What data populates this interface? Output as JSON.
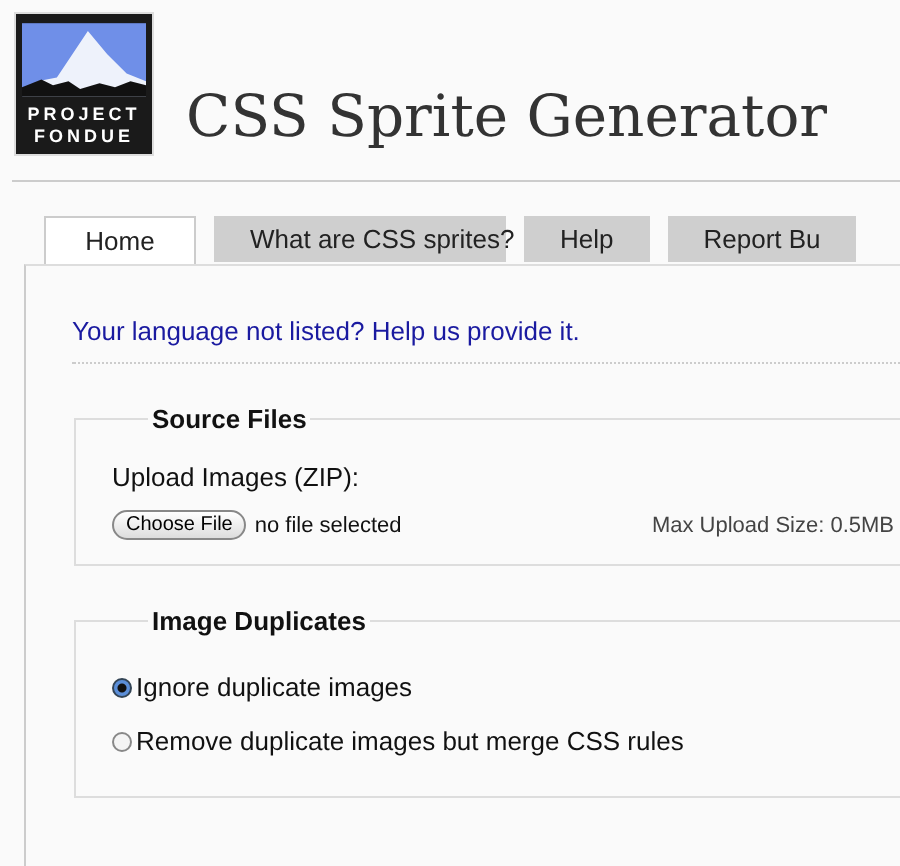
{
  "logo": {
    "line_1": "PROJECT",
    "line_2": "FONDUE"
  },
  "title": "CSS Sprite Generator",
  "tabs": [
    {
      "label": "Home",
      "selected": true
    },
    {
      "label": "What are CSS sprites?",
      "selected": false
    },
    {
      "label": "Help",
      "selected": false
    },
    {
      "label": "Report Bu",
      "selected": false
    }
  ],
  "language_link": "Your language not listed? Help us provide it.",
  "sections": [
    {
      "kind": "upload",
      "legend": "Source Files",
      "label": "Upload Images (ZIP):",
      "button": "Choose File",
      "file_status": "no file selected",
      "note": "Max Upload Size: 0.5MB"
    },
    {
      "kind": "radios",
      "legend": "Image Duplicates",
      "options": [
        {
          "label": "Ignore duplicate images",
          "selected": true
        },
        {
          "label": "Remove duplicate images but merge CSS rules",
          "selected": false
        }
      ]
    }
  ]
}
